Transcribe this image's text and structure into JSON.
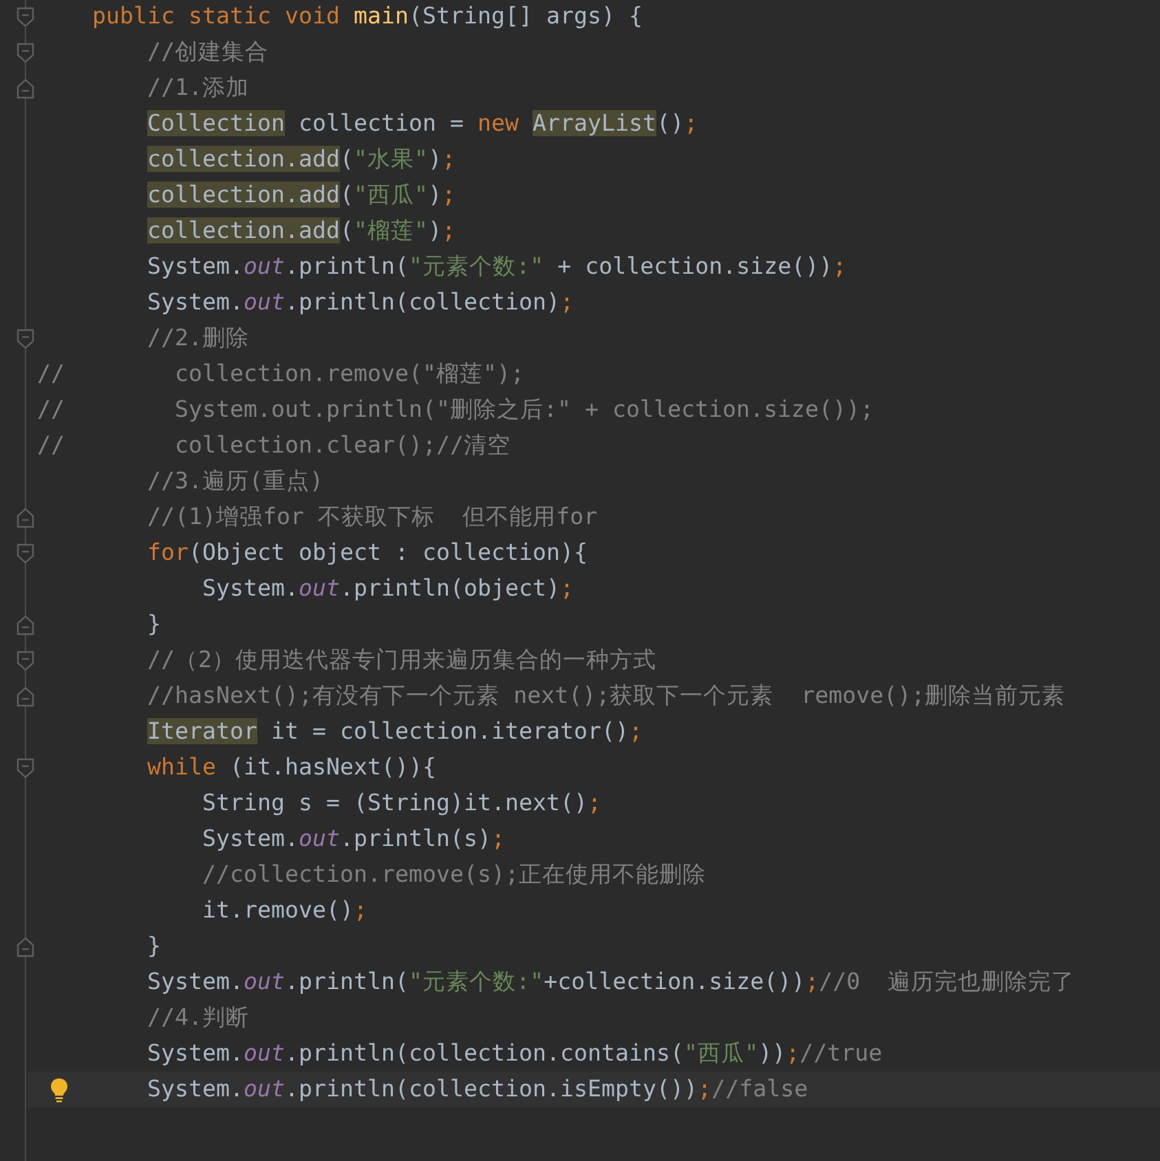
{
  "editor": {
    "lines": [
      {
        "kind": "code",
        "fold_start": true,
        "tokens": [
          {
            "kind": "keyword",
            "text": "    public static void "
          },
          {
            "kind": "method",
            "text": "main"
          },
          {
            "kind": "text",
            "text": "(String[] args) {"
          }
        ]
      },
      {
        "kind": "code",
        "fold_start": true,
        "tokens": [
          {
            "kind": "comment",
            "text": "        //创建集合"
          }
        ]
      },
      {
        "kind": "code",
        "fold_end": true,
        "tokens": [
          {
            "kind": "comment",
            "text": "        //1.添加"
          }
        ]
      },
      {
        "kind": "code",
        "tokens": [
          {
            "kind": "marked",
            "text": "        Collection"
          },
          {
            "kind": "text",
            "text": " collection = "
          },
          {
            "kind": "keyword",
            "text": "new "
          },
          {
            "kind": "marked",
            "text": "ArrayList"
          },
          {
            "kind": "text",
            "text": "()"
          },
          {
            "kind": "semicolon",
            "text": ";"
          }
        ]
      },
      {
        "kind": "code",
        "tokens": [
          {
            "kind": "marked",
            "text": "        collection.add"
          },
          {
            "kind": "text",
            "text": "("
          },
          {
            "kind": "string",
            "text": "\"水果\""
          },
          {
            "kind": "text",
            "text": ")"
          },
          {
            "kind": "semicolon",
            "text": ";"
          }
        ]
      },
      {
        "kind": "code",
        "tokens": [
          {
            "kind": "marked",
            "text": "        collection.add"
          },
          {
            "kind": "text",
            "text": "("
          },
          {
            "kind": "string",
            "text": "\"西瓜\""
          },
          {
            "kind": "text",
            "text": ")"
          },
          {
            "kind": "semicolon",
            "text": ";"
          }
        ]
      },
      {
        "kind": "code",
        "tokens": [
          {
            "kind": "marked",
            "text": "        collection.add"
          },
          {
            "kind": "text",
            "text": "("
          },
          {
            "kind": "string",
            "text": "\"榴莲\""
          },
          {
            "kind": "text",
            "text": ")"
          },
          {
            "kind": "semicolon",
            "text": ";"
          }
        ]
      },
      {
        "kind": "code",
        "tokens": [
          {
            "kind": "text",
            "text": "        System."
          },
          {
            "kind": "field",
            "text": "out"
          },
          {
            "kind": "text",
            "text": ".println("
          },
          {
            "kind": "string",
            "text": "\"元素个数:\""
          },
          {
            "kind": "text",
            "text": " + collection.size())"
          },
          {
            "kind": "semicolon",
            "text": ";"
          }
        ]
      },
      {
        "kind": "code",
        "tokens": [
          {
            "kind": "text",
            "text": "        System."
          },
          {
            "kind": "field",
            "text": "out"
          },
          {
            "kind": "text",
            "text": ".println(collection)"
          },
          {
            "kind": "semicolon",
            "text": ";"
          }
        ]
      },
      {
        "kind": "code",
        "fold_start": true,
        "tokens": [
          {
            "kind": "comment",
            "text": "        //2.删除"
          }
        ]
      },
      {
        "kind": "code",
        "tokens": [
          {
            "kind": "comment",
            "text": "//        collection.remove(\"榴莲\");"
          }
        ]
      },
      {
        "kind": "code",
        "tokens": [
          {
            "kind": "comment",
            "text": "//        System.out.println(\"删除之后:\" + collection.size());"
          }
        ]
      },
      {
        "kind": "code",
        "tokens": [
          {
            "kind": "comment",
            "text": "//        collection.clear();//清空"
          }
        ]
      },
      {
        "kind": "code",
        "tokens": [
          {
            "kind": "comment",
            "text": "        //3.遍历(重点)"
          }
        ]
      },
      {
        "kind": "code",
        "fold_end": true,
        "tokens": [
          {
            "kind": "comment",
            "text": "        //(1)增强for 不获取下标  但不能用for"
          }
        ]
      },
      {
        "kind": "code",
        "fold_start": true,
        "tokens": [
          {
            "kind": "keyword",
            "text": "        for"
          },
          {
            "kind": "text",
            "text": "(Object object : collection){"
          }
        ]
      },
      {
        "kind": "code",
        "tokens": [
          {
            "kind": "text",
            "text": "            System."
          },
          {
            "kind": "field",
            "text": "out"
          },
          {
            "kind": "text",
            "text": ".println(object)"
          },
          {
            "kind": "semicolon",
            "text": ";"
          }
        ]
      },
      {
        "kind": "code",
        "fold_end": true,
        "tokens": [
          {
            "kind": "text",
            "text": "        }"
          }
        ]
      },
      {
        "kind": "code",
        "fold_start": true,
        "tokens": [
          {
            "kind": "comment",
            "text": "        //（2）使用迭代器专门用来遍历集合的一种方式"
          }
        ]
      },
      {
        "kind": "code",
        "fold_end": true,
        "tokens": [
          {
            "kind": "comment",
            "text": "        //hasNext();有没有下一个元素 next();获取下一个元素  remove();删除当前元素"
          }
        ]
      },
      {
        "kind": "code",
        "tokens": [
          {
            "kind": "marked",
            "text": "        Iterator"
          },
          {
            "kind": "text",
            "text": " it = collection.iterator()"
          },
          {
            "kind": "semicolon",
            "text": ";"
          }
        ]
      },
      {
        "kind": "code",
        "fold_start": true,
        "tokens": [
          {
            "kind": "keyword",
            "text": "        while"
          },
          {
            "kind": "text",
            "text": " (it.hasNext()){"
          }
        ]
      },
      {
        "kind": "code",
        "tokens": [
          {
            "kind": "text",
            "text": "            String s = (String)it.next()"
          },
          {
            "kind": "semicolon",
            "text": ";"
          }
        ]
      },
      {
        "kind": "code",
        "tokens": [
          {
            "kind": "text",
            "text": "            System."
          },
          {
            "kind": "field",
            "text": "out"
          },
          {
            "kind": "text",
            "text": ".println(s)"
          },
          {
            "kind": "semicolon",
            "text": ";"
          }
        ]
      },
      {
        "kind": "code",
        "tokens": [
          {
            "kind": "comment",
            "text": "            //collection.remove(s);正在使用不能删除"
          }
        ]
      },
      {
        "kind": "code",
        "tokens": [
          {
            "kind": "text",
            "text": "            it.remove()"
          },
          {
            "kind": "semicolon",
            "text": ";"
          }
        ]
      },
      {
        "kind": "code",
        "fold_end": true,
        "tokens": [
          {
            "kind": "text",
            "text": "        }"
          }
        ]
      },
      {
        "kind": "code",
        "tokens": [
          {
            "kind": "text",
            "text": "        System."
          },
          {
            "kind": "field",
            "text": "out"
          },
          {
            "kind": "text",
            "text": ".println("
          },
          {
            "kind": "string",
            "text": "\"元素个数:\""
          },
          {
            "kind": "text",
            "text": "+collection.size())"
          },
          {
            "kind": "semicolon",
            "text": ";"
          },
          {
            "kind": "comment",
            "text": "//0  遍历完也删除完了"
          }
        ]
      },
      {
        "kind": "code",
        "tokens": [
          {
            "kind": "comment",
            "text": "        //4.判断"
          }
        ]
      },
      {
        "kind": "code",
        "tokens": [
          {
            "kind": "text",
            "text": "        System."
          },
          {
            "kind": "field",
            "text": "out"
          },
          {
            "kind": "text",
            "text": ".println(collection.contains("
          },
          {
            "kind": "string",
            "text": "\"西瓜\""
          },
          {
            "kind": "text",
            "text": "))"
          },
          {
            "kind": "semicolon",
            "text": ";"
          },
          {
            "kind": "comment",
            "text": "//true"
          }
        ]
      },
      {
        "kind": "code",
        "current": true,
        "bulb": true,
        "tokens": [
          {
            "kind": "text",
            "text": "        System."
          },
          {
            "kind": "field",
            "text": "out"
          },
          {
            "kind": "text",
            "text": ".println(collection.isEmpty())"
          },
          {
            "kind": "semicolon",
            "text": ";"
          },
          {
            "kind": "comment",
            "text": "//false"
          }
        ]
      },
      {
        "kind": "blank"
      }
    ]
  }
}
